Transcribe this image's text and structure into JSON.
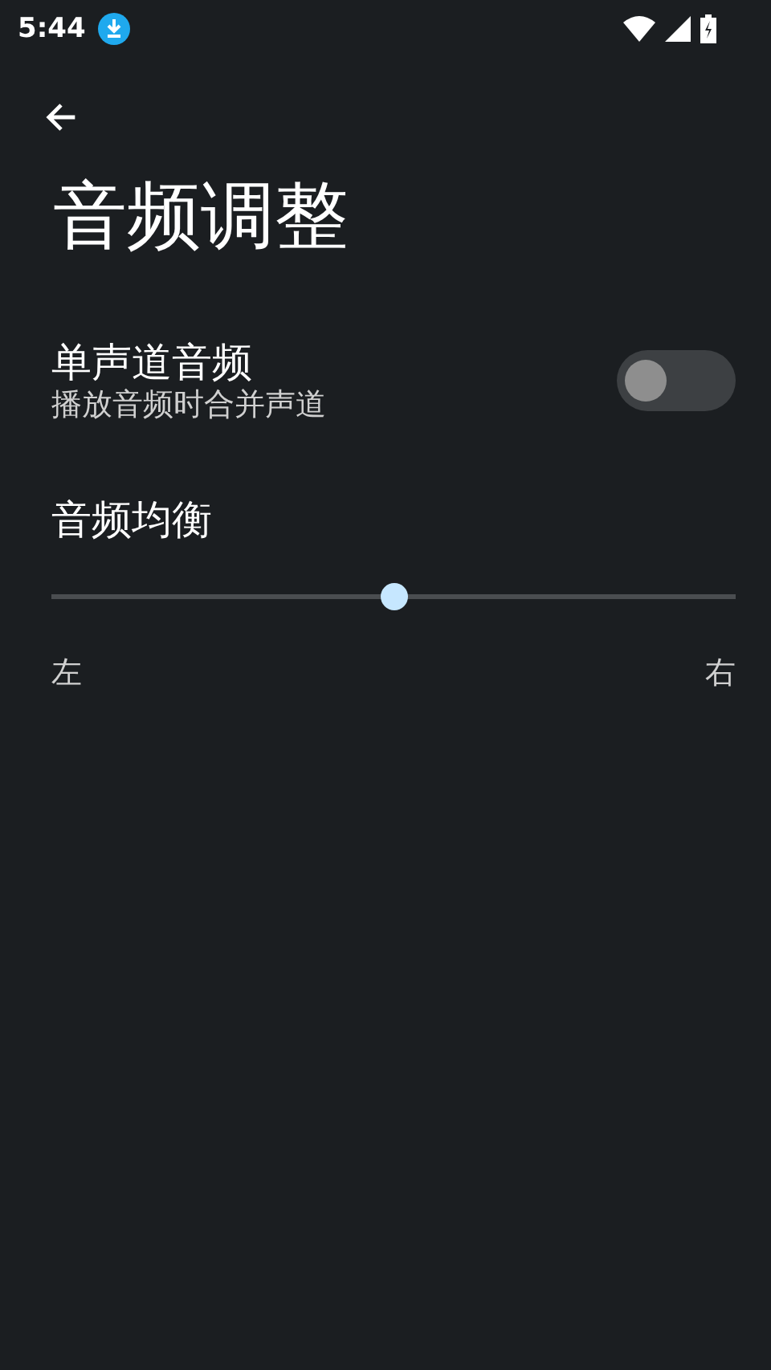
{
  "status_bar": {
    "time": "5:44"
  },
  "title": "音频调整",
  "settings": [
    {
      "kind": "toggle",
      "title": "单声道音频",
      "summary": "播放音频时合并声道",
      "on": false
    },
    {
      "kind": "slider",
      "title": "音频均衡",
      "level": 0.5,
      "min_label": "左",
      "max_label": "右"
    }
  ]
}
